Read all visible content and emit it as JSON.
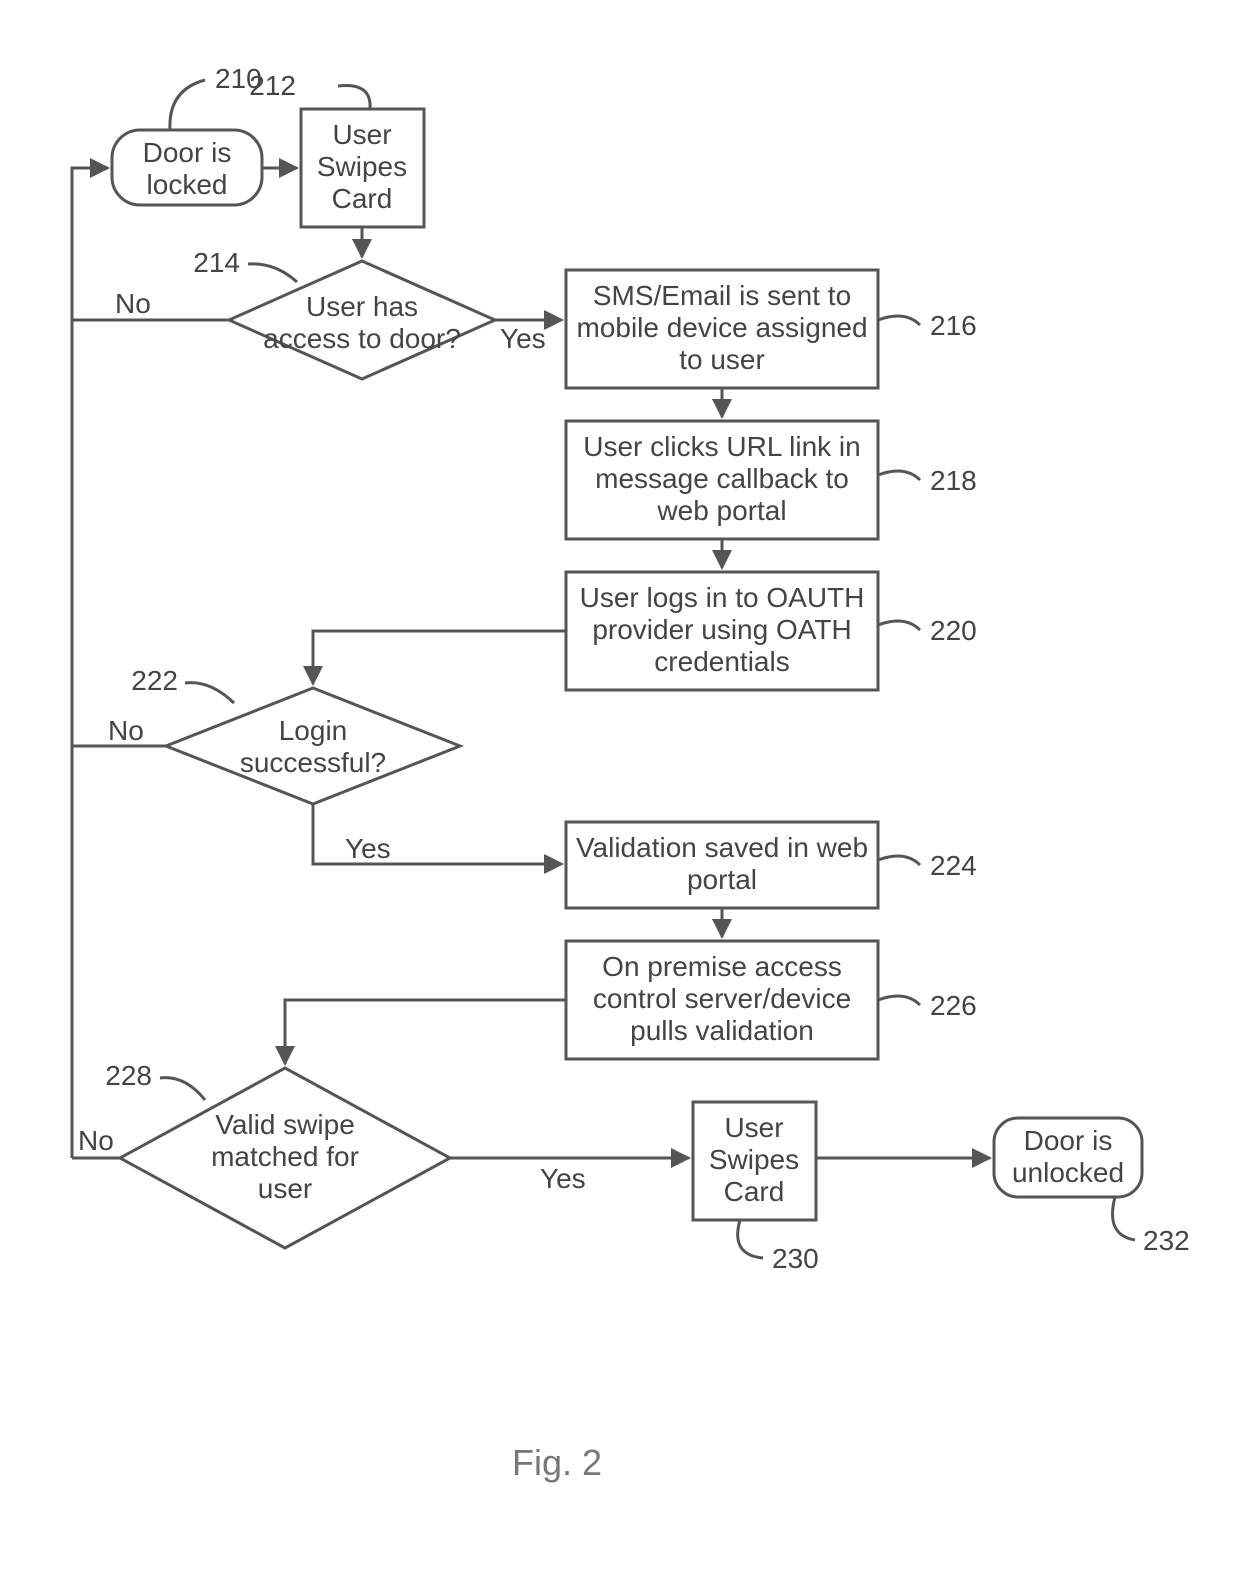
{
  "figure_label": "Fig. 2",
  "nodes": {
    "n210": {
      "ref": "210",
      "text1": "Door is",
      "text2": "locked"
    },
    "n212": {
      "ref": "212",
      "text1": "User",
      "text2": "Swipes",
      "text3": "Card"
    },
    "n214": {
      "ref": "214",
      "text1": "User has",
      "text2": "access to door?"
    },
    "n216": {
      "ref": "216",
      "text1": "SMS/Email is sent to",
      "text2": "mobile device assigned",
      "text3": "to user"
    },
    "n218": {
      "ref": "218",
      "text1": "User clicks URL link in",
      "text2": "message callback to",
      "text3": "web portal"
    },
    "n220": {
      "ref": "220",
      "text1": "User logs in to OAUTH",
      "text2": "provider using OATH",
      "text3": "credentials"
    },
    "n222": {
      "ref": "222",
      "text1": "Login",
      "text2": "successful?"
    },
    "n224": {
      "ref": "224",
      "text1": "Validation saved in web",
      "text2": "portal"
    },
    "n226": {
      "ref": "226",
      "text1": "On premise access",
      "text2": "control server/device",
      "text3": "pulls validation"
    },
    "n228": {
      "ref": "228",
      "text1": "Valid swipe",
      "text2": "matched for",
      "text3": "user"
    },
    "n230": {
      "ref": "230",
      "text1": "User",
      "text2": "Swipes",
      "text3": "Card"
    },
    "n232": {
      "ref": "232",
      "text1": "Door is",
      "text2": "unlocked"
    }
  },
  "edges": {
    "yes": "Yes",
    "no": "No"
  }
}
